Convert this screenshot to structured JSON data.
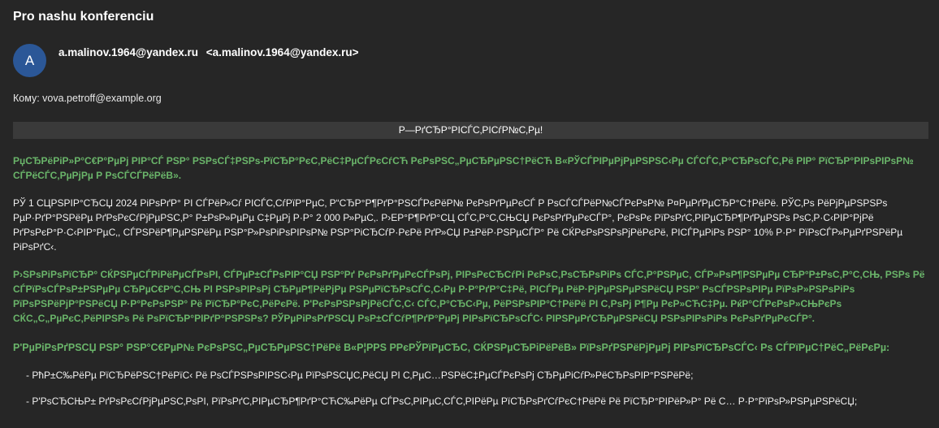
{
  "message": {
    "subject": "Pro nashu konferenciu",
    "avatar_letter": "A",
    "sender_name": "a.malinov.1964@yandex.ru",
    "sender_address": "<a.malinov.1964@yandex.ru>",
    "to_line": "Кому: vova.petroff@example.org"
  },
  "body": {
    "banner": "Р—РґСЂР°РІСЃС‚РІСѓР№С‚Рµ!",
    "paragraph_1": "РџСЂРёРіР»Р°С€Р°РµРј РІР°СЃ РЅР° РЅРѕСЃ‡РЅРѕ-РїСЂР°РєС‚РёС‡РµСЃРєСѓСЋ РєРѕРЅС„РµСЂРµРЅС†РёСЋ В«РЎСЃРІРµРјРµРЅРЅС‹Рµ СЃСЃС‚Р°СЂРѕСЃС‚Рё РІР° РїСЂР°РІРѕРІРѕР№ СЃРёСЃС‚РµРјРµ Р РѕСЃСЃРёРёВ».",
    "paragraph_2": "РЎ 1 СЦРЅРІР°СЂСЏ 2024 РіРѕРґР° РІ СЃРёР»Сѓ РІСЃС‚СѓРїР°РµС‚ Р“СЂР°Р¶РґР°РЅСЃРєРёР№ РєРѕРґРµРєСЃ Р РѕСЃСЃРёР№СЃРєРѕР№ Р¤РµРґРµСЂР°С†РёРё. РЎС‚Рѕ РёРјРµРЅРЅРѕ РµР·РґР°РЅРёРµ РґРѕРєСѓРјРµРЅС‚Р° Р±РѕР»РµРµ С‡РµРј Р·Р° 2 000 Р»РµС‚. Р›ЕР°Р¶РґР°СЦ СЃС‚Р°С‚СЊСЏ РєРѕРґРµРєСЃР°, РєРѕРє РїРѕРґС‚РІРµСЂР¶РґРµРЅРѕ РѕС‚Р·С‹РІР°РјРё РґРѕРєР°Р·С‹РІР°РµС‚, СЃРЅРёР¶РµРЅРёРµ РЅР°Р»РѕРіРѕРІРѕР№ РЅР°РіСЂСѓР·РєРё РґР»СЏ Р±РёР·РЅРµСЃР° Рё СЌРєРѕРЅРѕРјРёРєРё, РІСЃРµРіРѕ РЅР° 10% Р·Р° РїРѕСЃР»РµРґРЅРёРµ РіРѕРґС‹.",
    "paragraph_3": "Р›ЅРѕРіРѕРїСЂР° СЌРЅРµСЃРіРёРµСЃРѕРІ, СЃРµР±СЃРѕРІР°СЏ РЅР°Рґ РєРѕРґРµРєСЃРѕРј, РІРѕРєСЂСѓРі РєРѕС‚РѕСЂРѕРіРѕ СЃС‚Р°РЅРµС‚ СЃР»РѕР¶РЅРµРµ СЂР°Р±РѕС‚Р°С‚СЊ, РЅРѕ Рё СЃРїРѕСЃРѕР±РЅРµРµ СЂРµС€Р°С‚СЊ РІ РЅРѕРІРѕРј СЂРµР¶РёРјРµ РЅРµРїСЂРѕСЃС‚С‹Рµ Р·Р°РґР°С‡Рё, РІСЃРµ РёР·РјРµРЅРµРЅРёСЏ РЅР° РѕСЃРЅРѕРІРµ РїРѕР»РЅРѕРіРѕ РїРѕРЅРёРјР°РЅРёСЏ Р·Р°РєРѕРЅР° Рё РїСЂР°РєС‚РёРєРё. Р'РєРѕРЅРѕРјРёСЃС‚С‹ СЃС‚Р°СЂС‹Рµ, РёРЅРѕРІР°С†РёРё РІ С‚РѕРј Р¶Рµ РєР»СЋС‡Рµ. РќР°СЃРєРѕР»СЊРєРѕ СЌС„С„РµРєС‚РёРІРЅРѕ Рё РѕРїСЂР°РІРґР°РЅРЅРѕ? РЎРµРіРѕРґРЅСЏ РѕР±СЃСѓР¶РґР°РµРј РІРѕРїСЂРѕСЃС‹ РІРЅРµРґСЂРµРЅРёСЏ РЅРѕРІРѕРіРѕ РєРѕРґРµРєСЃР°.",
    "paragraph_4": "Р'РµРіРѕРґРЅСЏ РЅР° РЅР°С€РµР№ РєРѕРЅС„РµСЂРµРЅС†РёРё В«Р¦РРЅ РРєРЎРїРµСЂС‚ СЌРЅРµСЂРіРёРёВ» РїРѕРґРЅРёРјРµРј РІРѕРїСЂРѕСЃС‹ Рѕ СЃРїРµС†РёС„РёРєРµ:",
    "bullets": [
      "- РћР±С‰РёРµ РїСЂРёРЅС†РёРїС‹ Рё РѕСЃРЅРѕРІРЅС‹Рµ РїРѕРЅСЏС‚РёСЏ РІ С‚РµС…РЅРёС‡РµСЃРєРѕРј СЂРµРіСѓР»РёСЂРѕРІР°РЅРёРё;",
      "- Р'РѕСЂСЊР± РґРѕРєСѓРјРµРЅС‚РѕРІ, РїРѕРґС‚РІРµСЂР¶РґР°СЋС‰РёРµ СЃРѕС‚РІРµС‚СЃС‚РІРёРµ РїСЂРѕРґСѓРєС†РёРё Рё РїСЂР°РІРёР»Р° Рё С… Р·Р°РїРѕР»РЅРµРЅРёСЏ;"
    ]
  },
  "colors": {
    "background": "#262626",
    "avatar": "#2b5797",
    "green_text": "#6ab56a",
    "banner_bg": "#3a3a3a"
  }
}
